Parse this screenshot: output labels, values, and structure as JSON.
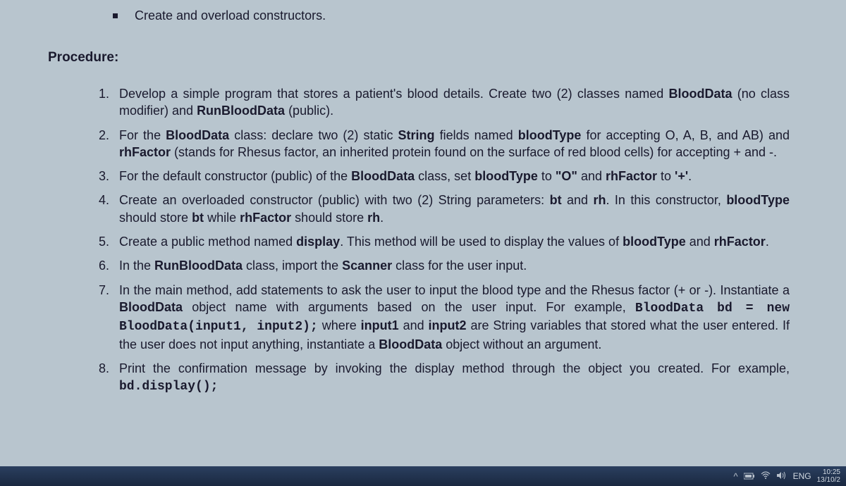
{
  "bullet_item": "Create and overload constructors.",
  "procedure_label": "Procedure:",
  "items": {
    "n1": "1.",
    "t1a": "Develop a simple program that stores a patient's blood details. Create two (2) classes named ",
    "t1b": "BloodData",
    "t1c": " (no class modifier) and ",
    "t1d": "RunBloodData",
    "t1e": " (public).",
    "n2": "2.",
    "t2a": "For the ",
    "t2b": "BloodData",
    "t2c": " class: declare two (2) static ",
    "t2d": "String",
    "t2e": " fields named ",
    "t2f": "bloodType",
    "t2g": " for accepting O, A, B, and AB) and ",
    "t2h": "rhFactor",
    "t2i": " (stands for Rhesus factor, an inherited protein found on the surface of red blood cells) for accepting + and -.",
    "n3": "3.",
    "t3a": "For the default constructor (public) of the ",
    "t3b": "BloodData",
    "t3c": " class, set ",
    "t3d": "bloodType",
    "t3e": " to ",
    "t3f": "\"O\"",
    "t3g": " and ",
    "t3h": "rhFactor",
    "t3i": " to ",
    "t3j": "'+'",
    "t3k": ".",
    "n4": "4.",
    "t4a": "Create an overloaded constructor (public) with two (2) String parameters: ",
    "t4b": "bt",
    "t4c": " and ",
    "t4d": "rh",
    "t4e": ". In this constructor, ",
    "t4f": "bloodType",
    "t4g": " should store ",
    "t4h": "bt",
    "t4i": " while ",
    "t4j": "rhFactor",
    "t4k": " should store ",
    "t4l": "rh",
    "t4m": ".",
    "n5": "5.",
    "t5a": "Create a public method named ",
    "t5b": "display",
    "t5c": ". This method will be used to display the values of ",
    "t5d": "bloodType",
    "t5e": " and ",
    "t5f": "rhFactor",
    "t5g": ".",
    "n6": "6.",
    "t6a": "In the ",
    "t6b": "RunBloodData",
    "t6c": " class, import the ",
    "t6d": "Scanner",
    "t6e": " class for the user input.",
    "n7": "7.",
    "t7a": "In the main method, add statements to ask the user to input the blood type and the Rhesus factor (+ or -). Instantiate a ",
    "t7b": "BloodData",
    "t7c": " object name with arguments based on the user input. For example, ",
    "t7d": "BloodData bd = new BloodData(input1, input2);",
    "t7e": " where ",
    "t7f": "input1",
    "t7g": " and ",
    "t7h": "input2",
    "t7i": " are String variables that stored what the user entered. If the user does not input anything, instantiate a ",
    "t7j": "BloodData",
    "t7k": " object without an argument.",
    "n8": "8.",
    "t8a": "Print the confirmation message by invoking the display method through the object you created. For example, ",
    "t8b": "bd.display();"
  },
  "taskbar": {
    "chevron": "^",
    "lang": "ENG",
    "time": "10:25",
    "date": "13/10/2"
  }
}
